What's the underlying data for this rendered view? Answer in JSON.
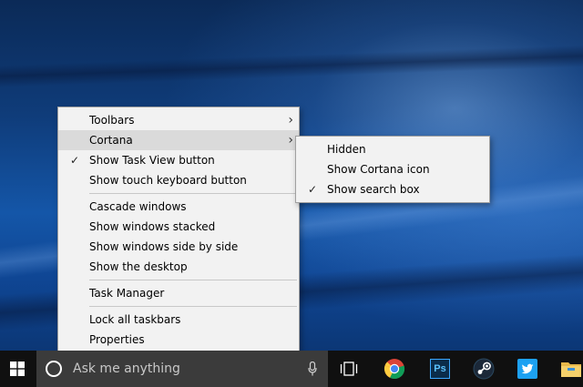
{
  "context_menu": {
    "items": [
      {
        "label": "Toolbars",
        "has_submenu": true
      },
      {
        "label": "Cortana",
        "has_submenu": true
      },
      {
        "label": "Show Task View button",
        "checked": true
      },
      {
        "label": "Show touch keyboard button"
      },
      {
        "label": "Cascade windows"
      },
      {
        "label": "Show windows stacked"
      },
      {
        "label": "Show windows side by side"
      },
      {
        "label": "Show the desktop"
      },
      {
        "label": "Task Manager"
      },
      {
        "label": "Lock all taskbars"
      },
      {
        "label": "Properties"
      }
    ],
    "highlighted_item": "Cortana"
  },
  "cortana_submenu": {
    "items": [
      {
        "label": "Hidden"
      },
      {
        "label": "Show Cortana icon"
      },
      {
        "label": "Show search box",
        "checked": true
      }
    ]
  },
  "taskbar": {
    "search_placeholder": "Ask me anything",
    "pinned_apps": [
      "task-view-icon",
      "chrome-icon",
      "photoshop-icon",
      "steam-icon",
      "twitter-icon",
      "file-explorer-icon"
    ],
    "photoshop_label": "Ps",
    "colors": {
      "background": "#101010",
      "search_box": "#3b3b3b"
    }
  },
  "glyphs": {
    "check": "✓",
    "arrow": "›"
  }
}
